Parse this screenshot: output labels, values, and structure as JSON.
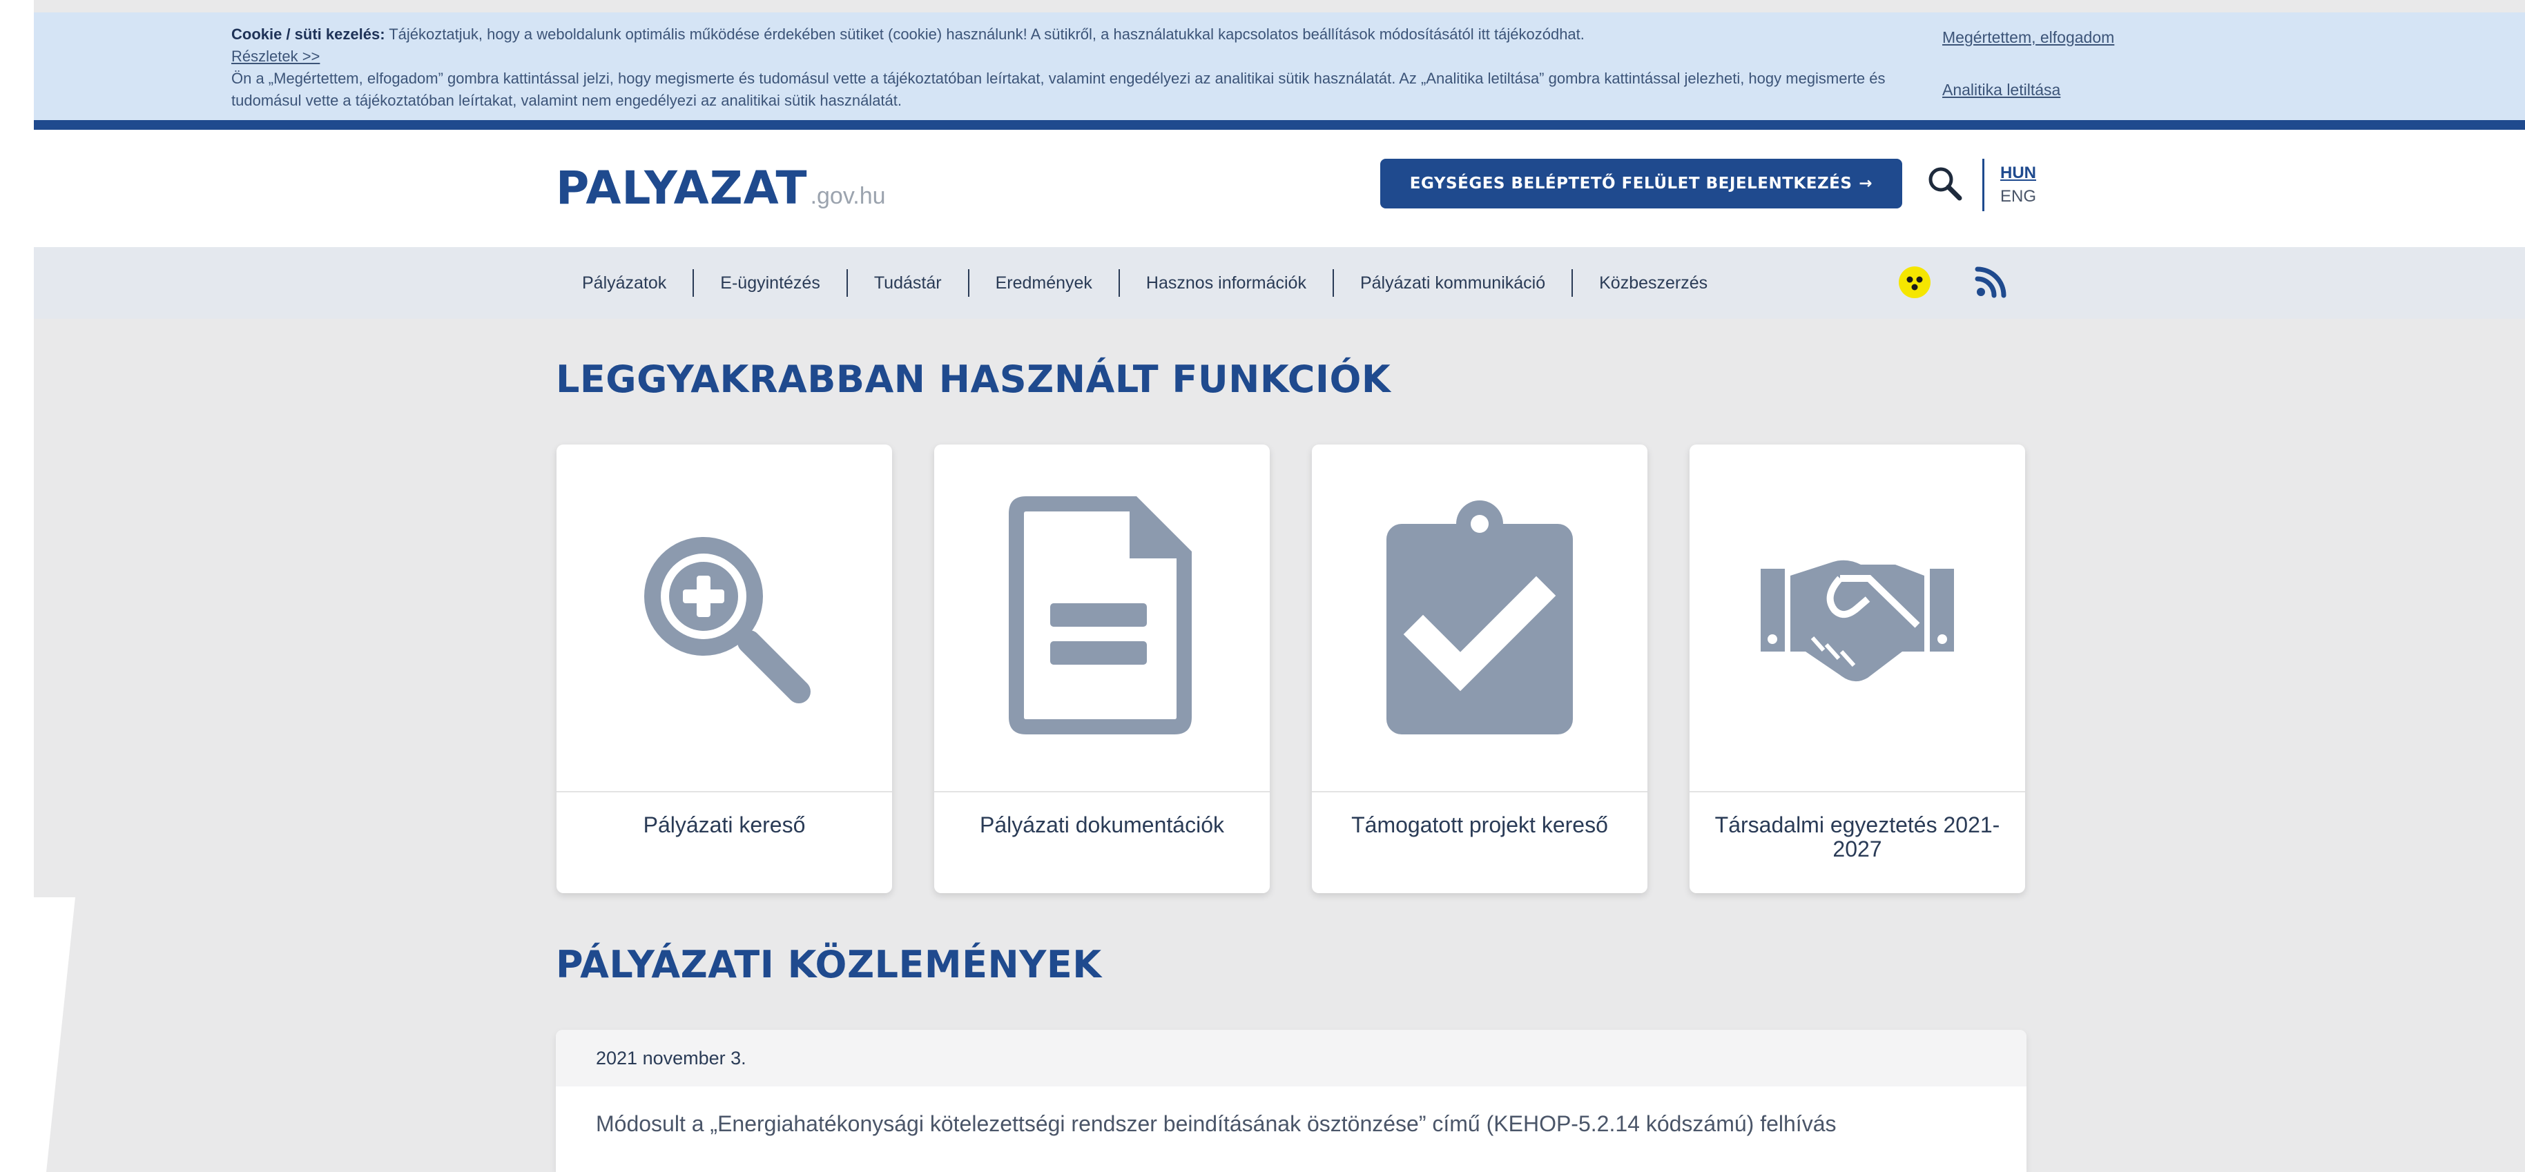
{
  "cookie": {
    "title": "Cookie / süti kezelés:",
    "line1": " Tájékoztatjuk, hogy a weboldalunk optimális működése érdekében sütiket (cookie) használunk! A sütikről, a használatukkal kapcsolatos beállítások módosításától itt tájékozódhat.",
    "details_link": "Részletek >>",
    "line2": "Ön a „Megértettem, elfogadom” gombra kattintással jelzi, hogy megismerte és tudomásul vette a tájékoztatóban leírtakat, valamint engedélyezi az analitikai sütik használatát. Az „Analitika letiltása” gombra kattintással jelezheti, hogy megismerte és tudomásul vette a tájékoztatóban leírtakat, valamint nem engedélyezi az analitikai sütik használatát.",
    "accept_link": "Megértettem, elfogadom",
    "disable_link": "Analitika letiltása"
  },
  "header": {
    "logo_main": "PALYAZAT",
    "logo_sub": ".gov.hu",
    "login_button": "EGYSÉGES BELÉPTETŐ FELÜLET BEJELENTKEZÉS",
    "login_arrow": "→",
    "lang_active": "HUN",
    "lang_other": "ENG"
  },
  "nav": {
    "items": [
      {
        "label": "Pályázatok"
      },
      {
        "label": "E-ügyintézés"
      },
      {
        "label": "Tudástár"
      },
      {
        "label": "Eredmények"
      },
      {
        "label": "Hasznos információk"
      },
      {
        "label": "Pályázati kommunikáció"
      },
      {
        "label": "Közbeszerzés"
      }
    ]
  },
  "functions": {
    "title": "LEGGYAKRABBAN HASZNÁLT FUNKCIÓK",
    "cards": [
      {
        "label": "Pályázati kereső",
        "icon": "search-plus-icon"
      },
      {
        "label": "Pályázati dokumentációk",
        "icon": "document-icon"
      },
      {
        "label": "Támogatott projekt kereső",
        "icon": "clipboard-check-icon"
      },
      {
        "label": "Társadalmi egyeztetés 2021-2027",
        "icon": "handshake-icon"
      }
    ]
  },
  "notices": {
    "title": "PÁLYÁZATI KÖZLEMÉNYEK",
    "items": [
      {
        "date": "2021 november 3.",
        "text": "Módosult a „Energiahatékonysági kötelezettségi rendszer beindításának ösztönzése” című (KEHOP-5.2.14 kódszámú) felhívás"
      }
    ]
  },
  "colors": {
    "primary": "#1f4a8e",
    "cookie_bg": "#d5e4f5",
    "page_bg": "#e9e9ea",
    "icon_gray": "#8c9aae",
    "accessibility_yellow": "#f5e600"
  }
}
